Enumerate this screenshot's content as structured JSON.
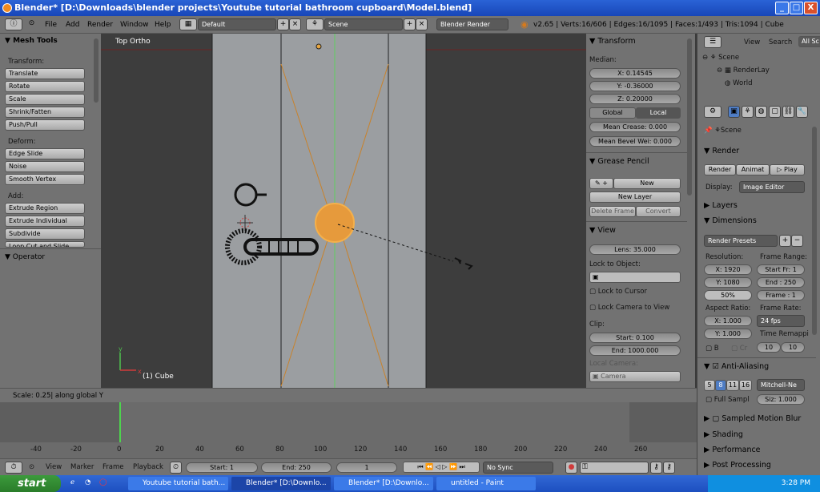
{
  "window": {
    "title": "Blender* [D:\\Downloads\\blender projects\\Youtube tutorial bathroom cupboard\\Model.blend]",
    "min": "_",
    "max": "□",
    "close": "X"
  },
  "topbar": {
    "menus": [
      "File",
      "Add",
      "Render",
      "Window",
      "Help"
    ],
    "layout": "Default",
    "scene": "Scene",
    "engine": "Blender Render",
    "stats": "v2.65 | Verts:16/606 | Edges:16/1095 | Faces:1/493 | Tris:1094 | Cube"
  },
  "toolbar": {
    "title": "Mesh Tools",
    "transform_label": "Transform:",
    "transform": [
      "Translate",
      "Rotate",
      "Scale",
      "Shrink/Fatten",
      "Push/Pull"
    ],
    "deform_label": "Deform:",
    "deform": [
      "Edge Slide",
      "Noise",
      "Smooth Vertex"
    ],
    "add_label": "Add:",
    "add": [
      "Extrude Region",
      "Extrude Individual",
      "Subdivide",
      "Loop Cut and Slide"
    ],
    "operator": "Operator"
  },
  "viewport": {
    "view_name": "Top Ortho",
    "object_label": "(1) Cube",
    "axis_x": "x",
    "axis_y": "y"
  },
  "nprops": {
    "transform": "Transform",
    "median": "Median:",
    "x": "X: 0.14545",
    "y": "Y: -0.36000",
    "z": "Z: 0.20000",
    "global": "Global",
    "local": "Local",
    "crease": "Mean Crease: 0.000",
    "bevel": "Mean Bevel Wei: 0.000",
    "grease": "Grease Pencil",
    "new": "New",
    "new_layer": "New Layer",
    "delete_frame": "Delete Frame",
    "convert": "Convert",
    "view": "View",
    "lens": "Lens: 35.000",
    "lock_object": "Lock to Object:",
    "lock_cursor": "Lock to Cursor",
    "lock_camera": "Lock Camera to View",
    "clip": "Clip:",
    "start": "Start: 0.100",
    "end": "End: 1000.000",
    "local_camera": "Local Camera:",
    "camera": "Camera"
  },
  "outliner": {
    "view": "View",
    "search": "Search",
    "all": "All Sc",
    "items": [
      "Scene",
      "RenderLay",
      "World"
    ]
  },
  "props": {
    "scene": "Scene",
    "render": "Render",
    "render_btn": "Render",
    "anim_btn": "Animat",
    "play_btn": "Play",
    "display_label": "Display:",
    "display": "Image Editor",
    "layers": "Layers",
    "dimensions": "Dimensions",
    "presets": "Render Presets",
    "resolution": "Resolution:",
    "frame_range": "Frame Range:",
    "res_x": "X: 1920",
    "res_y": "Y: 1080",
    "pct": "50%",
    "start_fr": "Start Fr: 1",
    "end_fr": "End : 250",
    "frame": "Frame : 1",
    "aspect": "Aspect Ratio:",
    "frame_rate": "Frame Rate:",
    "asp_x": "X: 1.000",
    "asp_y": "Y: 1.000",
    "fps": "24 fps",
    "time_remap": "Time Remappi",
    "b": "B",
    "cr": "Cr",
    "remap_a": "10",
    "remap_b": "10",
    "aa": "Anti-Aliasing",
    "aa_samples": [
      "5",
      "8",
      "11",
      "16"
    ],
    "filter": "Mitchell-Ne",
    "full_sample": "Full Sampl",
    "size": "Siz: 1.000",
    "motion_blur": "Sampled Motion Blur",
    "shading": "Shading",
    "performance": "Performance",
    "post": "Post Processing"
  },
  "status": "Scale: 0.25| along global Y",
  "timeline": {
    "ticks": [
      "-40",
      "-20",
      "0",
      "20",
      "40",
      "60",
      "80",
      "100",
      "120",
      "140",
      "160",
      "180",
      "200",
      "220",
      "240",
      "260"
    ],
    "view": "View",
    "marker": "Marker",
    "frame": "Frame",
    "playback": "Playback",
    "start": "Start: 1",
    "end": "End: 250",
    "current": "1",
    "sync": "No Sync"
  },
  "taskbar": {
    "start": "start",
    "tasks": [
      "Youtube tutorial bath...",
      "Blender* [D:\\Downlo...",
      "Blender* [D:\\Downlo...",
      "untitled - Paint"
    ],
    "time": "3:28 PM"
  }
}
